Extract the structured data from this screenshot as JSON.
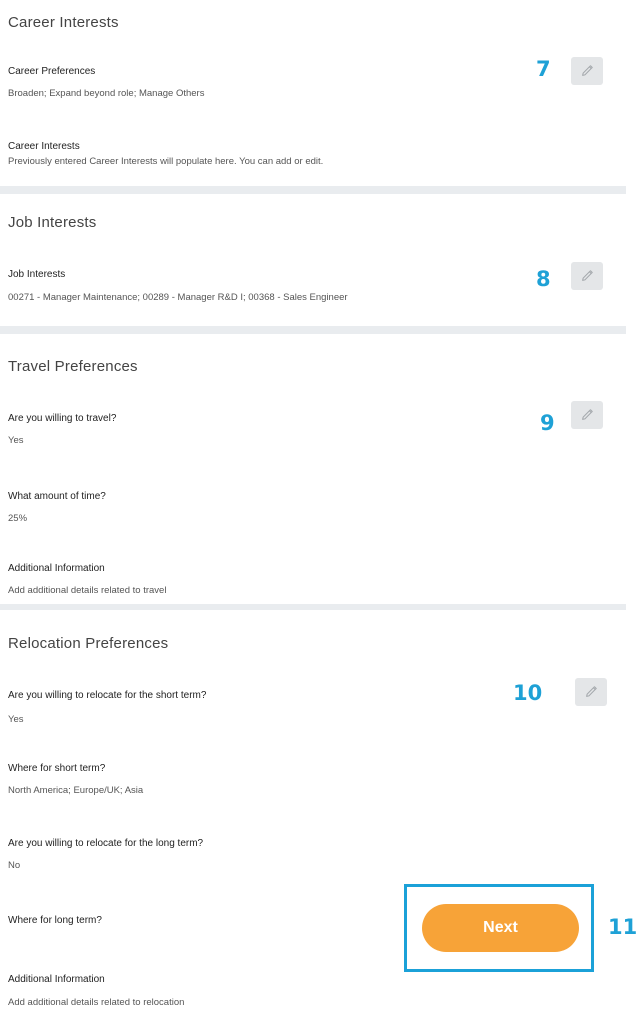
{
  "career": {
    "title": "Career Interests",
    "step": "7",
    "preferences_label": "Career Preferences",
    "preferences_value": "Broaden; Expand beyond role; Manage Others",
    "interests_label": "Career Interests",
    "interests_value": "Previously entered Career Interests will populate here. You can add or edit."
  },
  "job": {
    "title": "Job Interests",
    "step": "8",
    "interests_label": "Job Interests",
    "interests_value": "00271 - Manager Maintenance; 00289 - Manager R&D I; 00368 - Sales Engineer"
  },
  "travel": {
    "title": "Travel Preferences",
    "step": "9",
    "willing_label": "Are you willing to travel?",
    "willing_value": "Yes",
    "time_label": "What amount of time?",
    "time_value": "25%",
    "info_label": "Additional Information",
    "info_value": "Add additional details related to travel"
  },
  "relocation": {
    "title": "Relocation Preferences",
    "step": "10",
    "short_label": "Are you willing to relocate for the short term?",
    "short_value": "Yes",
    "short_where_label": "Where for short term?",
    "short_where_value": "North America; Europe/UK; Asia",
    "long_label": "Are you willing to relocate for the long term?",
    "long_value": "No",
    "long_where_label": "Where for long term?",
    "info_label": "Additional Information",
    "info_value": "Add additional details related to relocation"
  },
  "next": {
    "label": "Next",
    "step": "11"
  },
  "icons": {
    "edit": "pencil-icon"
  },
  "colors": {
    "step_number": "#1ea1d6",
    "next_button": "#f7a338",
    "highlight_box": "#1ba1d8",
    "divider": "#e9ecef"
  }
}
